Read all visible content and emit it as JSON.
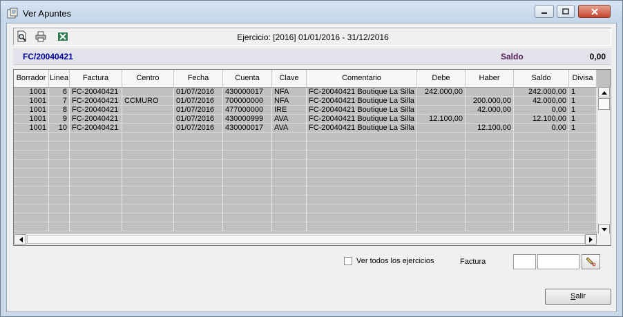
{
  "window": {
    "title": "Ver Apuntes",
    "controls": [
      "minimize",
      "maximize",
      "close"
    ]
  },
  "toolbar": {
    "icons": [
      "preview-icon",
      "print-icon",
      "excel-export-icon"
    ],
    "ejercicio": "Ejercicio: [2016] 01/01/2016 - 31/12/2016"
  },
  "header": {
    "factura": "FC/20040421",
    "saldo_label": "Saldo",
    "saldo_value": "0,00"
  },
  "grid": {
    "columns": [
      "Borrador",
      "Linea",
      "Factura",
      "Centro",
      "Fecha",
      "Cuenta",
      "Clave",
      "Comentario",
      "Debe",
      "Haber",
      "Saldo",
      "Divisa"
    ],
    "rows": [
      [
        "1001",
        "6",
        "FC-20040421",
        "",
        "01/07/2016",
        "430000017",
        "NFA",
        "FC-20040421 Boutique La Silla",
        "242.000,00",
        "",
        "242.000,00",
        "1"
      ],
      [
        "1001",
        "7",
        "FC-20040421",
        "CCMURO",
        "01/07/2016",
        "700000000",
        "NFA",
        "FC-20040421 Boutique La Silla",
        "",
        "200.000,00",
        "42.000,00",
        "1"
      ],
      [
        "1001",
        "8",
        "FC-20040421",
        "",
        "01/07/2016",
        "477000000",
        "IRE",
        "FC-20040421 Boutique La Silla",
        "",
        "42.000,00",
        "0,00",
        "1"
      ],
      [
        "1001",
        "9",
        "FC-20040421",
        "",
        "01/07/2016",
        "430000999",
        "AVA",
        "FC-20040421 Boutique La Silla",
        "12.100,00",
        "",
        "12.100,00",
        "1"
      ],
      [
        "1001",
        "10",
        "FC-20040421",
        "",
        "01/07/2016",
        "430000017",
        "AVA",
        "FC-20040421 Boutique La Silla",
        "",
        "12.100,00",
        "0,00",
        "1"
      ]
    ]
  },
  "footer": {
    "ver_todos_label": "Ver todos los ejercicios",
    "ver_todos_checked": false,
    "factura_label": "Factura",
    "factura_serie": "",
    "factura_numero": "",
    "salir_label": "Salir"
  }
}
